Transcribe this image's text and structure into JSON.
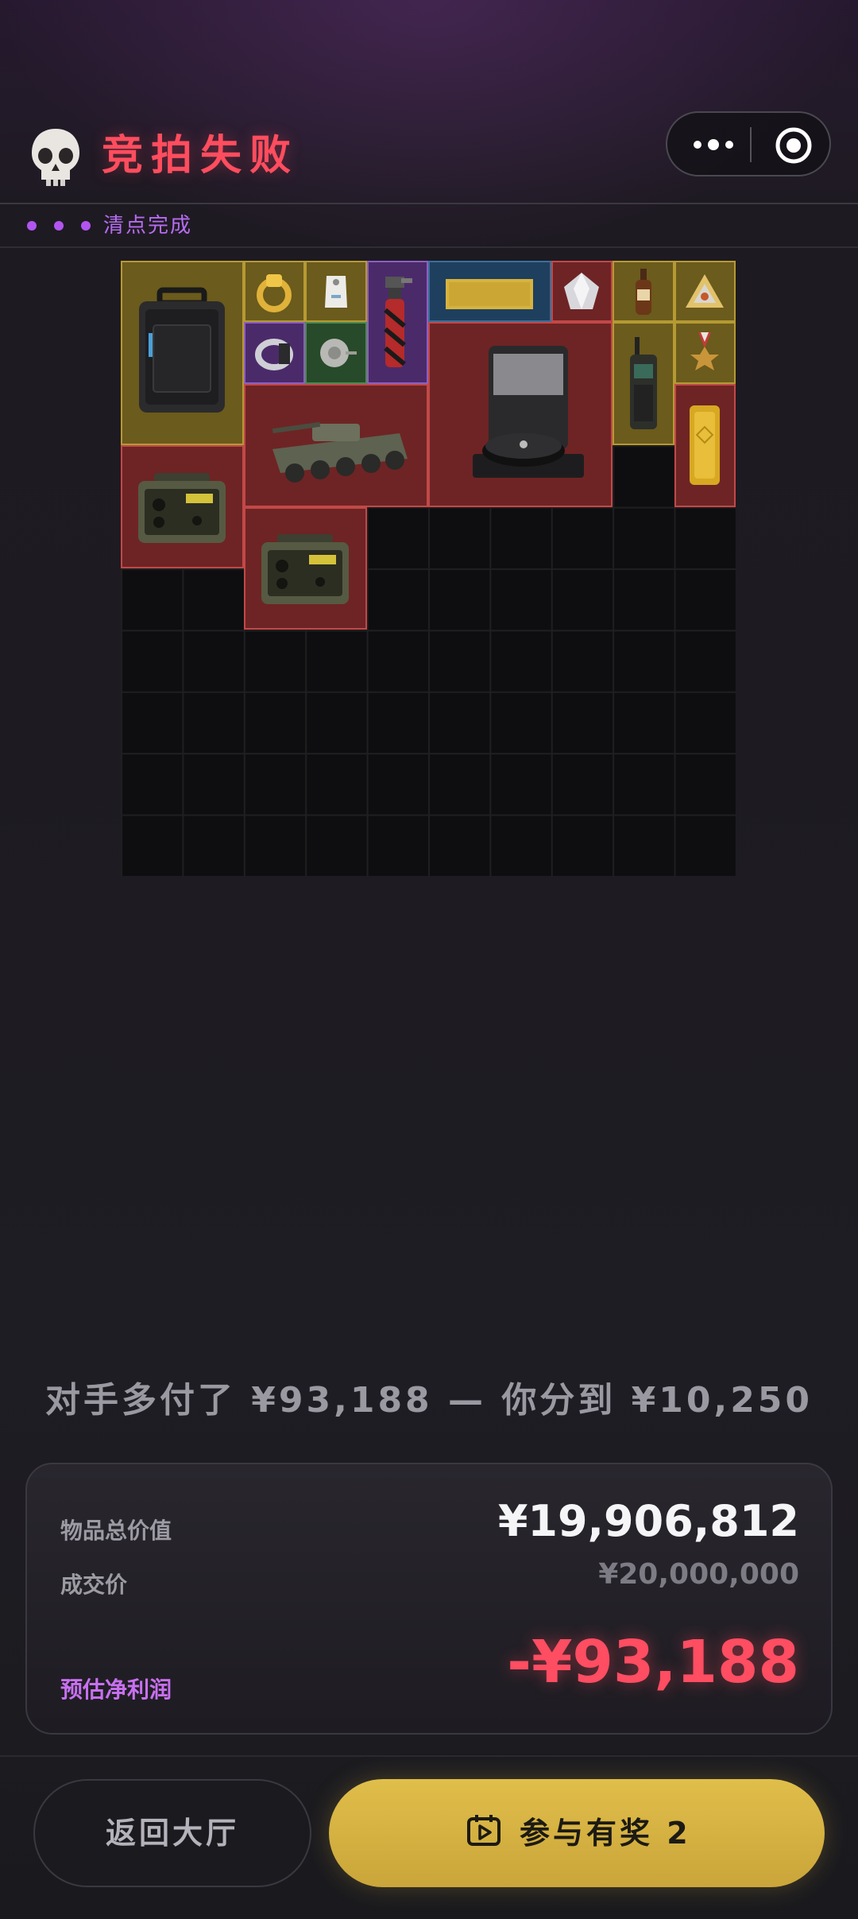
{
  "header": {
    "title": "竞拍失败",
    "skull_icon": "skull-icon",
    "more_icon": "more-dots-icon",
    "target_icon": "target-circle-icon"
  },
  "status": {
    "label": "清点完成",
    "dot_color": "#b255f0"
  },
  "grid": {
    "columns": 10,
    "rows": 10,
    "items": [
      {
        "name": "hard-case-icon",
        "rarity": "gold"
      },
      {
        "name": "gold-ring-icon",
        "rarity": "gold"
      },
      {
        "name": "white-tag-icon",
        "rarity": "gold"
      },
      {
        "name": "torch-lighter-icon",
        "rarity": "purple"
      },
      {
        "name": "gold-bar-plate-icon",
        "rarity": "blue"
      },
      {
        "name": "diamond-icon",
        "rarity": "red"
      },
      {
        "name": "bottle-icon",
        "rarity": "gold"
      },
      {
        "name": "pendant-icon",
        "rarity": "gold"
      },
      {
        "name": "silver-ring-icon",
        "rarity": "purple"
      },
      {
        "name": "dish-icon",
        "rarity": "green"
      },
      {
        "name": "robot-vacuum-icon",
        "rarity": "red"
      },
      {
        "name": "radio-phone-icon",
        "rarity": "gold"
      },
      {
        "name": "medal-icon",
        "rarity": "gold"
      },
      {
        "name": "armored-vehicle-icon",
        "rarity": "red"
      },
      {
        "name": "gold-bar-icon",
        "rarity": "red"
      },
      {
        "name": "military-radio-icon",
        "rarity": "red"
      },
      {
        "name": "military-radio-icon",
        "rarity": "red"
      }
    ]
  },
  "summary": {
    "tagline": "对手多付了 ¥93,188 — 你分到 ¥10,250",
    "total_value_label": "物品总价值",
    "total_value": "¥19,906,812",
    "deal_price_label": "成交价",
    "deal_price": "¥20,000,000",
    "net_profit_label": "预估净利润",
    "net_profit": "-¥93,188",
    "profit_color": "#ff4d62"
  },
  "actions": {
    "back_label": "返回大厅",
    "join_label": "参与有奖 2",
    "join_icon": "play-calendar-icon",
    "join_color": "#d8b444"
  }
}
